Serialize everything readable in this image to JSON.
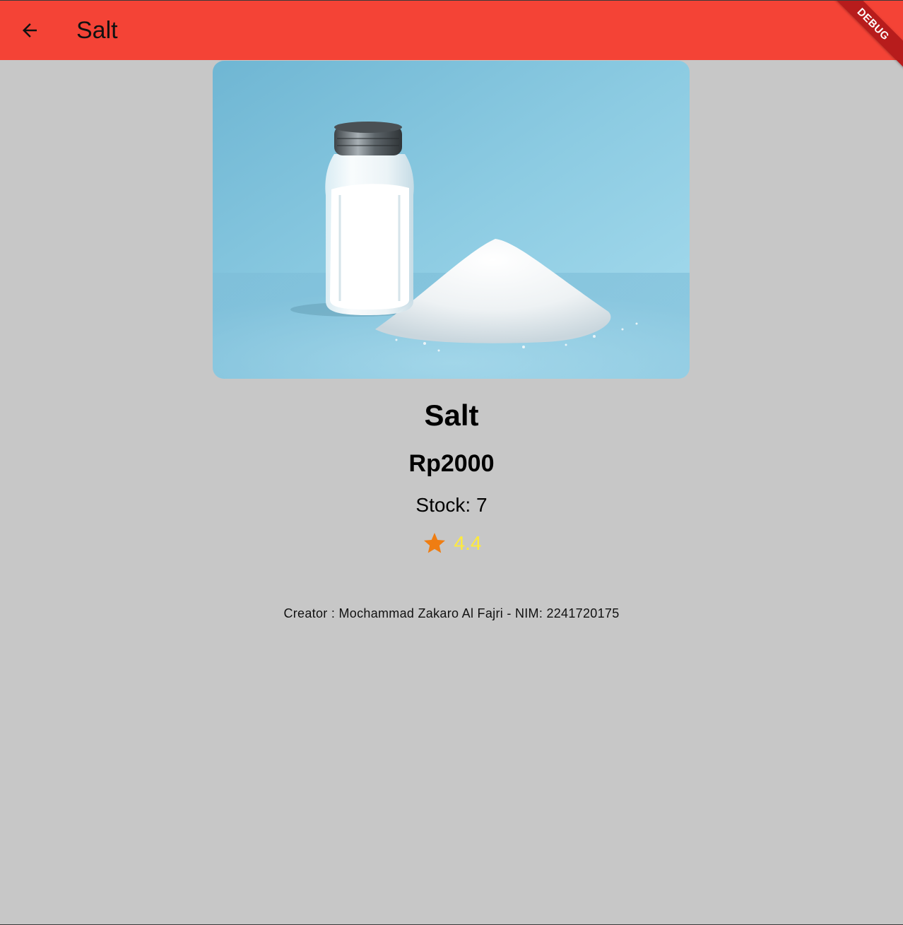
{
  "appbar": {
    "title": "Salt",
    "back_icon": "arrow-back-icon",
    "background": "#f44336"
  },
  "debug_banner": {
    "label": "DEBUG"
  },
  "product": {
    "image_alt": "Salt shaker with pile of salt",
    "name": "Salt",
    "price": "Rp2000",
    "stock": "Stock: 7",
    "rating": "4.4",
    "rating_icon": "star-icon",
    "star_color": "#ef7d12",
    "rating_color": "#ffeb3b"
  },
  "footer": {
    "creator": "Creator : Mochammad Zakaro Al Fajri - NIM: 2241720175"
  }
}
